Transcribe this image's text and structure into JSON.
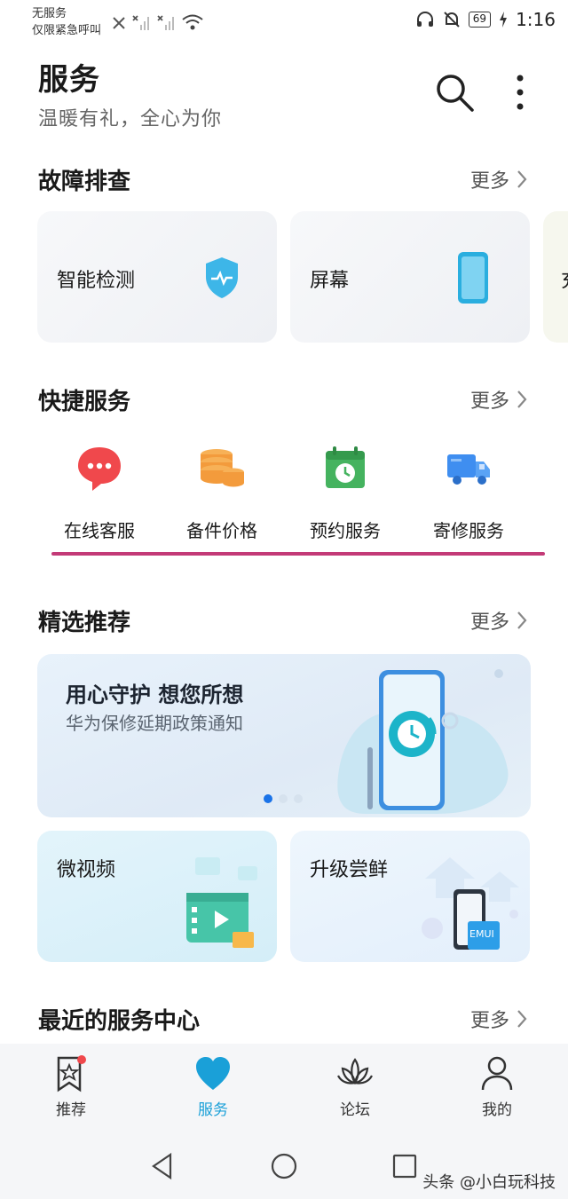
{
  "status_bar": {
    "line1": "无服务",
    "line2": "仅限紧急呼叫",
    "battery": "69",
    "time": "1:16"
  },
  "header": {
    "title": "服务",
    "subtitle": "温暖有礼，全心为你"
  },
  "sections": {
    "troubleshoot": {
      "title": "故障排查",
      "more": "更多"
    },
    "quick": {
      "title": "快捷服务",
      "more": "更多"
    },
    "featured": {
      "title": "精选推荐",
      "more": "更多"
    },
    "nearby": {
      "title": "最近的服务中心",
      "more": "更多"
    }
  },
  "troubleshoot_cards": [
    {
      "label": "智能检测",
      "icon": "shield-icon"
    },
    {
      "label": "屏幕",
      "icon": "phone-screen-icon"
    },
    {
      "label": "充",
      "icon": ""
    }
  ],
  "quick_services": [
    {
      "label": "在线客服",
      "icon": "chat-bubble-icon"
    },
    {
      "label": "备件价格",
      "icon": "coins-icon"
    },
    {
      "label": "预约服务",
      "icon": "calendar-clock-icon"
    },
    {
      "label": "寄修服务",
      "icon": "delivery-truck-icon"
    }
  ],
  "banner": {
    "title": "用心守护 想您所想",
    "subtitle": "华为保修延期政策通知"
  },
  "mini_cards": [
    {
      "label": "微视频",
      "icon": "video-icon"
    },
    {
      "label": "升级尝鲜",
      "icon": "emui-phone-icon",
      "badge": "EMUI"
    }
  ],
  "bottom_nav": [
    {
      "label": "推荐",
      "icon": "bookmark-star-icon",
      "active": false
    },
    {
      "label": "服务",
      "icon": "heart-icon",
      "active": true
    },
    {
      "label": "论坛",
      "icon": "lotus-icon",
      "active": false
    },
    {
      "label": "我的",
      "icon": "person-icon",
      "active": false
    }
  ],
  "watermark": "头条 @小白玩科技",
  "colors": {
    "accent": "#1aa0d8",
    "divider": "#c33a77",
    "chat": "#f0484c",
    "coins": "#f39b3c",
    "calendar": "#45b35f",
    "truck": "#3f8ef0"
  }
}
